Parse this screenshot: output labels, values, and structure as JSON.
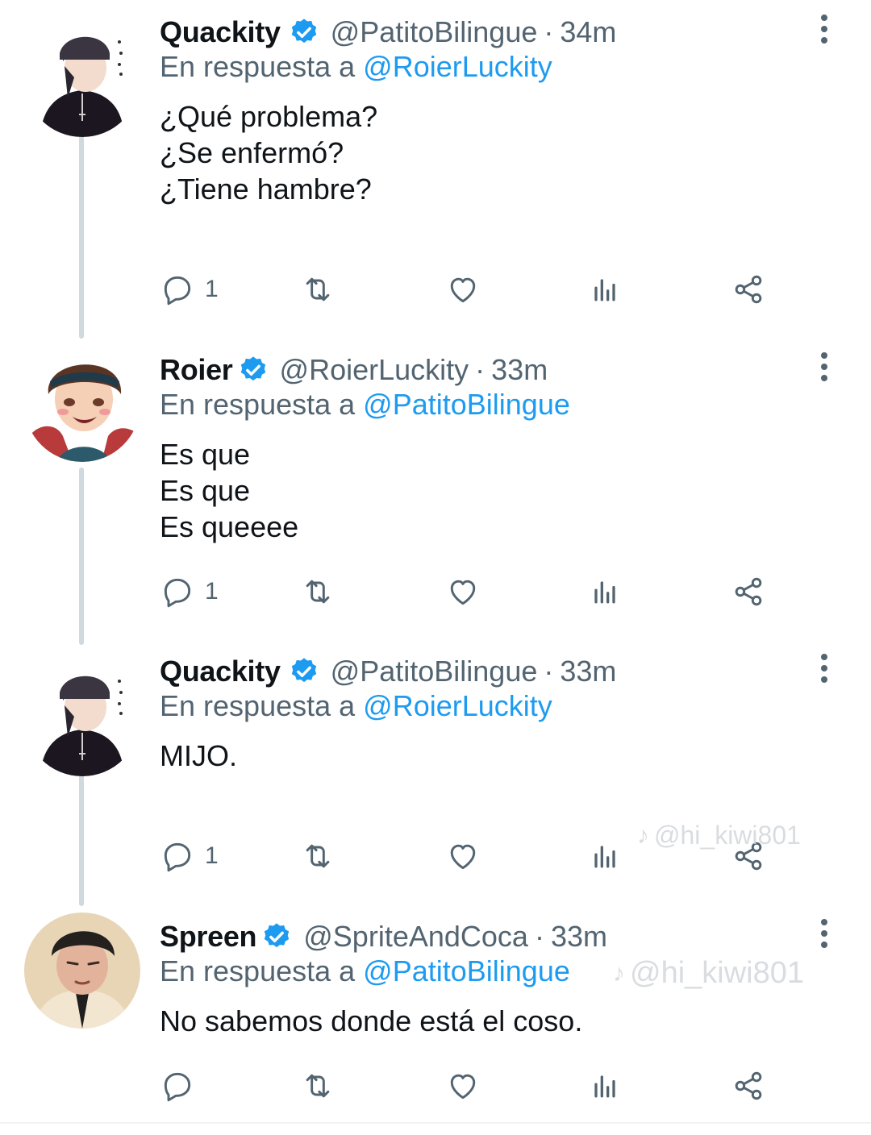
{
  "tweets": [
    {
      "name": "Quackity",
      "handle": "@PatitoBilingue",
      "separator": "·",
      "time": "34m",
      "reply_prefix": "En respuesta a",
      "reply_to": "@RoierLuckity",
      "lines": [
        "¿Qué problema?",
        "¿Se enfermó?",
        "¿Tiene hambre?"
      ],
      "reply_count": "1"
    },
    {
      "name": "Roier",
      "handle": "@RoierLuckity",
      "separator": "·",
      "time": "33m",
      "reply_prefix": "En respuesta a",
      "reply_to": "@PatitoBilingue",
      "lines": [
        "Es que",
        "Es que",
        "Es queeee"
      ],
      "reply_count": "1"
    },
    {
      "name": "Quackity",
      "handle": "@PatitoBilingue",
      "separator": "·",
      "time": "33m",
      "reply_prefix": "En respuesta a",
      "reply_to": "@RoierLuckity",
      "lines": [
        "MIJO."
      ],
      "reply_count": "1"
    },
    {
      "name": "Spreen",
      "handle": "@SpriteAndCoca",
      "separator": "·",
      "time": "33m",
      "reply_prefix": "En respuesta a",
      "reply_to": "@PatitoBilingue",
      "lines": [
        "No sabemos donde está el coso."
      ],
      "reply_count": ""
    }
  ],
  "watermarks": [
    "@hi_kiwi801",
    "@hi_kiwi801"
  ],
  "colors": {
    "accent": "#1d9bf0",
    "text": "#0f1419",
    "secondary": "#536471",
    "thread_line": "#cfd9de"
  },
  "icons": {
    "verified": "verified-badge-icon",
    "reply": "reply-bubble-icon",
    "retweet": "retweet-icon",
    "like": "heart-icon",
    "views": "views-chart-icon",
    "share": "share-icon",
    "more": "more-vertical-icon"
  }
}
